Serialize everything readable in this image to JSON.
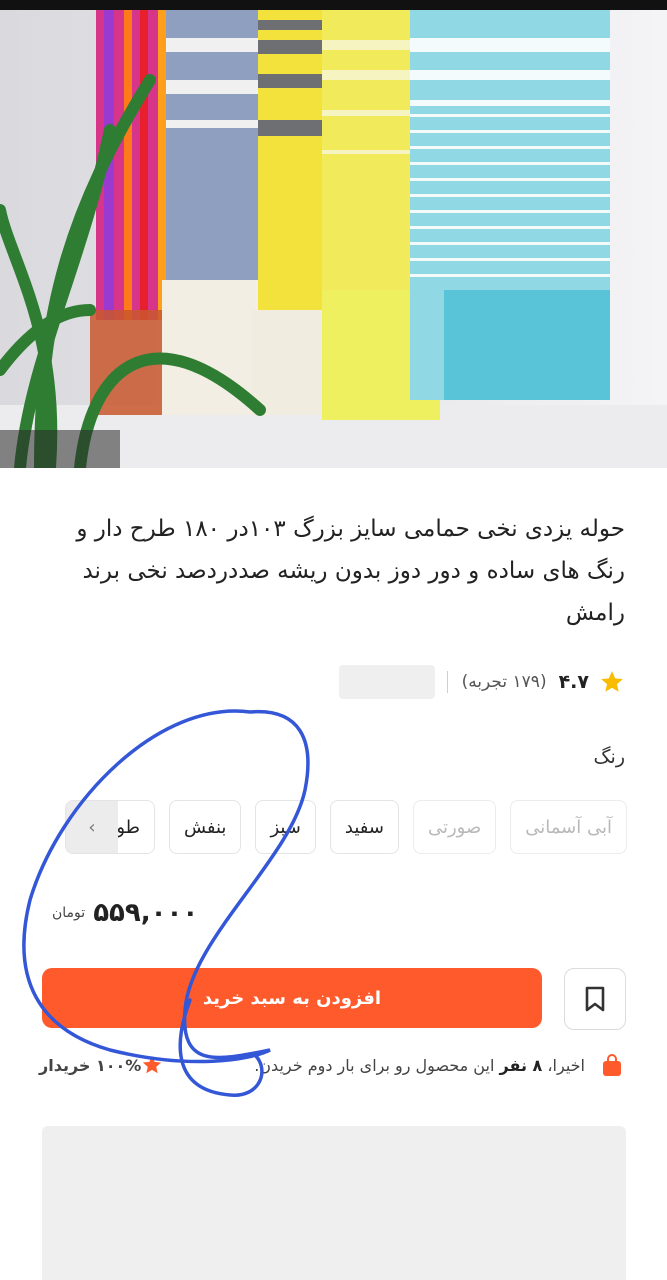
{
  "product": {
    "title": "حوله یزدی نخی حمامی سایز بزرگ ۱۰۳در ۱۸۰ طرح دار و رنگ های ساده و دور دوز بدون ریشه صددردصد نخی برند رامش"
  },
  "rating": {
    "value": "۴.۷",
    "reviews": "(۱۷۹ تجربه)"
  },
  "colors": {
    "label": "رنگ",
    "options": [
      {
        "label": "آبی آسمانی",
        "available": false
      },
      {
        "label": "صورتی",
        "available": false
      },
      {
        "label": "سفید",
        "available": true
      },
      {
        "label": "سبز",
        "available": true
      },
      {
        "label": "بنفش",
        "available": true
      },
      {
        "label": "طو",
        "available": true
      }
    ],
    "more_icon": "chevron-left-icon"
  },
  "price": {
    "value": "۵۵۹,۰۰۰",
    "currency": "تومان"
  },
  "actions": {
    "add_to_cart": "افزودن به سبد خرید",
    "bookmark_icon": "bookmark-icon"
  },
  "info": {
    "recent_prefix": "اخیرا،",
    "recent_count": "۸ نفر",
    "recent_suffix": "این محصول رو برای بار دوم خریدن.",
    "satisfaction": "۱۰۰% خریدار"
  },
  "theme": {
    "accent": "#ff5a2b",
    "star": "#f9bc00",
    "annotation": "#3357d6"
  }
}
